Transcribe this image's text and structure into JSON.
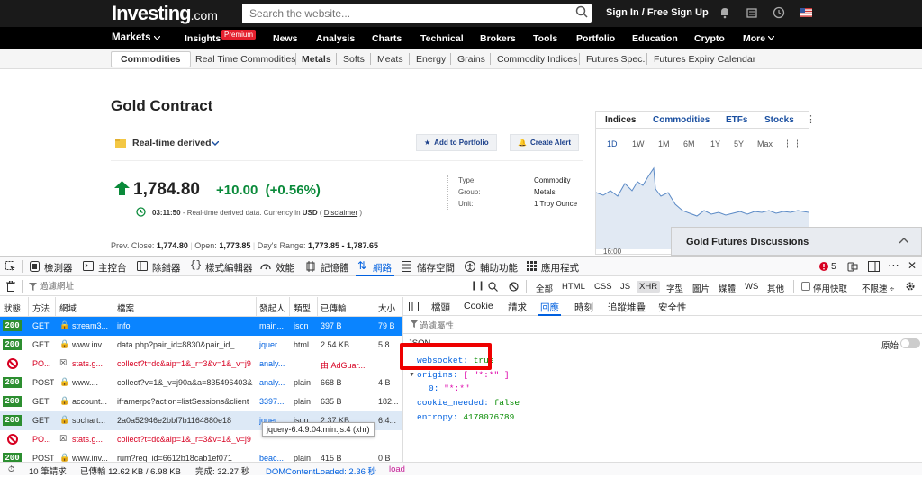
{
  "site": {
    "logo": "Investing",
    "logo_suffix": ".com",
    "search_placeholder": "Search the website...",
    "signin": "Sign In / Free Sign Up"
  },
  "nav": {
    "items": [
      "Markets",
      "Insights",
      "News",
      "Analysis",
      "Charts",
      "Technical",
      "Brokers",
      "Tools",
      "Portfolio",
      "Education",
      "Crypto",
      "More"
    ],
    "premium_badge": "Premium"
  },
  "subnav": [
    "Commodities",
    "Real Time Commodities",
    "Metals",
    "Softs",
    "Meats",
    "Energy",
    "Grains",
    "Commodity Indices",
    "Futures Spec.",
    "Futures Expiry Calendar"
  ],
  "instrument": {
    "title": "Gold Contract",
    "realtime": "Real-time derived",
    "add_portfolio": "Add to Portfolio",
    "create_alert": "Create Alert",
    "price": "1,784.80",
    "change": "+10.00",
    "change_pct": "(+0.56%)",
    "time": "03:11:50",
    "time_note": " - Real-time derived data. Currency in ",
    "currency": "USD",
    "disclaimer": "Disclaimer",
    "type_label": "Type:",
    "type_value": "Commodity",
    "group_label": "Group:",
    "group_value": "Metals",
    "unit_label": "Unit:",
    "unit_value": "1 Troy Ounce",
    "prev_close_label": "Prev. Close:",
    "prev_close": "1,774.80",
    "open_label": "Open:",
    "open": "1,773.85",
    "range_label": "Day's Range:",
    "range": "1,773.85 - 1,787.65"
  },
  "right_panel": {
    "tabs": [
      "Indices",
      "Commodities",
      "ETFs",
      "Stocks"
    ],
    "ranges": [
      "1D",
      "1W",
      "1M",
      "6M",
      "1Y",
      "5Y",
      "Max"
    ],
    "time_label": "16:00",
    "discussions": "Gold Futures Discussions"
  },
  "devtools": {
    "tabs": [
      "檢測器",
      "主控台",
      "除錯器",
      "樣式編輯器",
      "效能",
      "記憶體",
      "網路",
      "儲存空間",
      "輔助功能",
      "應用程式"
    ],
    "error_count": "5",
    "filter_placeholder": "過濾網址",
    "type_filters": [
      "全部",
      "HTML",
      "CSS",
      "JS",
      "XHR",
      "字型",
      "圖片",
      "媒體",
      "WS",
      "其他"
    ],
    "disable_cache": "停用快取",
    "throttle": "不限速 ÷",
    "columns": [
      "狀態",
      "方法",
      "網域",
      "檔案",
      "發起人",
      "類型",
      "已傳輸",
      "大小"
    ],
    "rows": [
      {
        "status": "200",
        "method": "GET",
        "domain": "stream3...",
        "file": "info",
        "initiator": "main...",
        "type": "json",
        "transferred": "397 B",
        "size": "79 B",
        "selected": true
      },
      {
        "status": "200",
        "method": "GET",
        "domain": "www.inv...",
        "file": "data.php?pair_id=8830&pair_id_",
        "initiator": "jquer...",
        "type": "html",
        "transferred": "2.54 KB",
        "size": "5.8..."
      },
      {
        "status": "blocked",
        "method": "PO...",
        "domain": "stats.g...",
        "file": "collect?t=dc&aip=1&_r=3&v=1&_v=j9",
        "initiator": "analy...",
        "type": "",
        "transferred": "由 AdGuar...",
        "size": ""
      },
      {
        "status": "200",
        "method": "POST",
        "domain": "www....",
        "file": "collect?v=1&_v=j90a&a=835496403&",
        "initiator": "analy...",
        "type": "plain",
        "transferred": "668 B",
        "size": "4 B"
      },
      {
        "status": "200",
        "method": "GET",
        "domain": "account...",
        "file": "iframerpc?action=listSessions&client",
        "initiator": "3397...",
        "type": "plain",
        "transferred": "635 B",
        "size": "182..."
      },
      {
        "status": "200",
        "method": "GET",
        "domain": "sbchart...",
        "file": "2a0a52946e2bbf7b1164880e18",
        "initiator": "jquer...",
        "type": "json",
        "transferred": "2.37 KB",
        "size": "6.4...",
        "hl": true
      },
      {
        "status": "blocked",
        "method": "PO...",
        "domain": "stats.g...",
        "file": "collect?t=dc&aip=1&_r=3&v=1&_v=j9",
        "initiator": "",
        "type": "",
        "transferred": "",
        "size": ""
      },
      {
        "status": "200",
        "method": "POST",
        "domain": "www.inv...",
        "file": "rum?req_id=6612b18cab1ef071",
        "initiator": "beac...",
        "type": "plain",
        "transferred": "415 B",
        "size": "0 B"
      }
    ],
    "tooltip": "jquery-6.4.9.04.min.js:4 (xhr)",
    "side_tabs": [
      "檔頭",
      "Cookie",
      "請求",
      "回應",
      "時刻",
      "追蹤堆疊",
      "安全性"
    ],
    "side_filter": "過濾屬性",
    "json_label": "JSON",
    "raw_label": "原始",
    "json": {
      "websocket_key": "websocket:",
      "websocket_val": "true",
      "origins_key": "origins:",
      "origins_val": "[ \"*:*\" ]",
      "zero_key": "0:",
      "zero_val": "\"*:*\"",
      "cookie_key": "cookie_needed:",
      "cookie_val": "false",
      "entropy_key": "entropy:",
      "entropy_val": "4178076789"
    },
    "statusbar": {
      "requests": "10 筆請求",
      "transferred": "已傳輸 12.62 KB / 6.98 KB",
      "finish": "完成: 32.27 秒",
      "dcl": "DOMContentLoaded: 2.36 秒",
      "load": "load"
    }
  }
}
